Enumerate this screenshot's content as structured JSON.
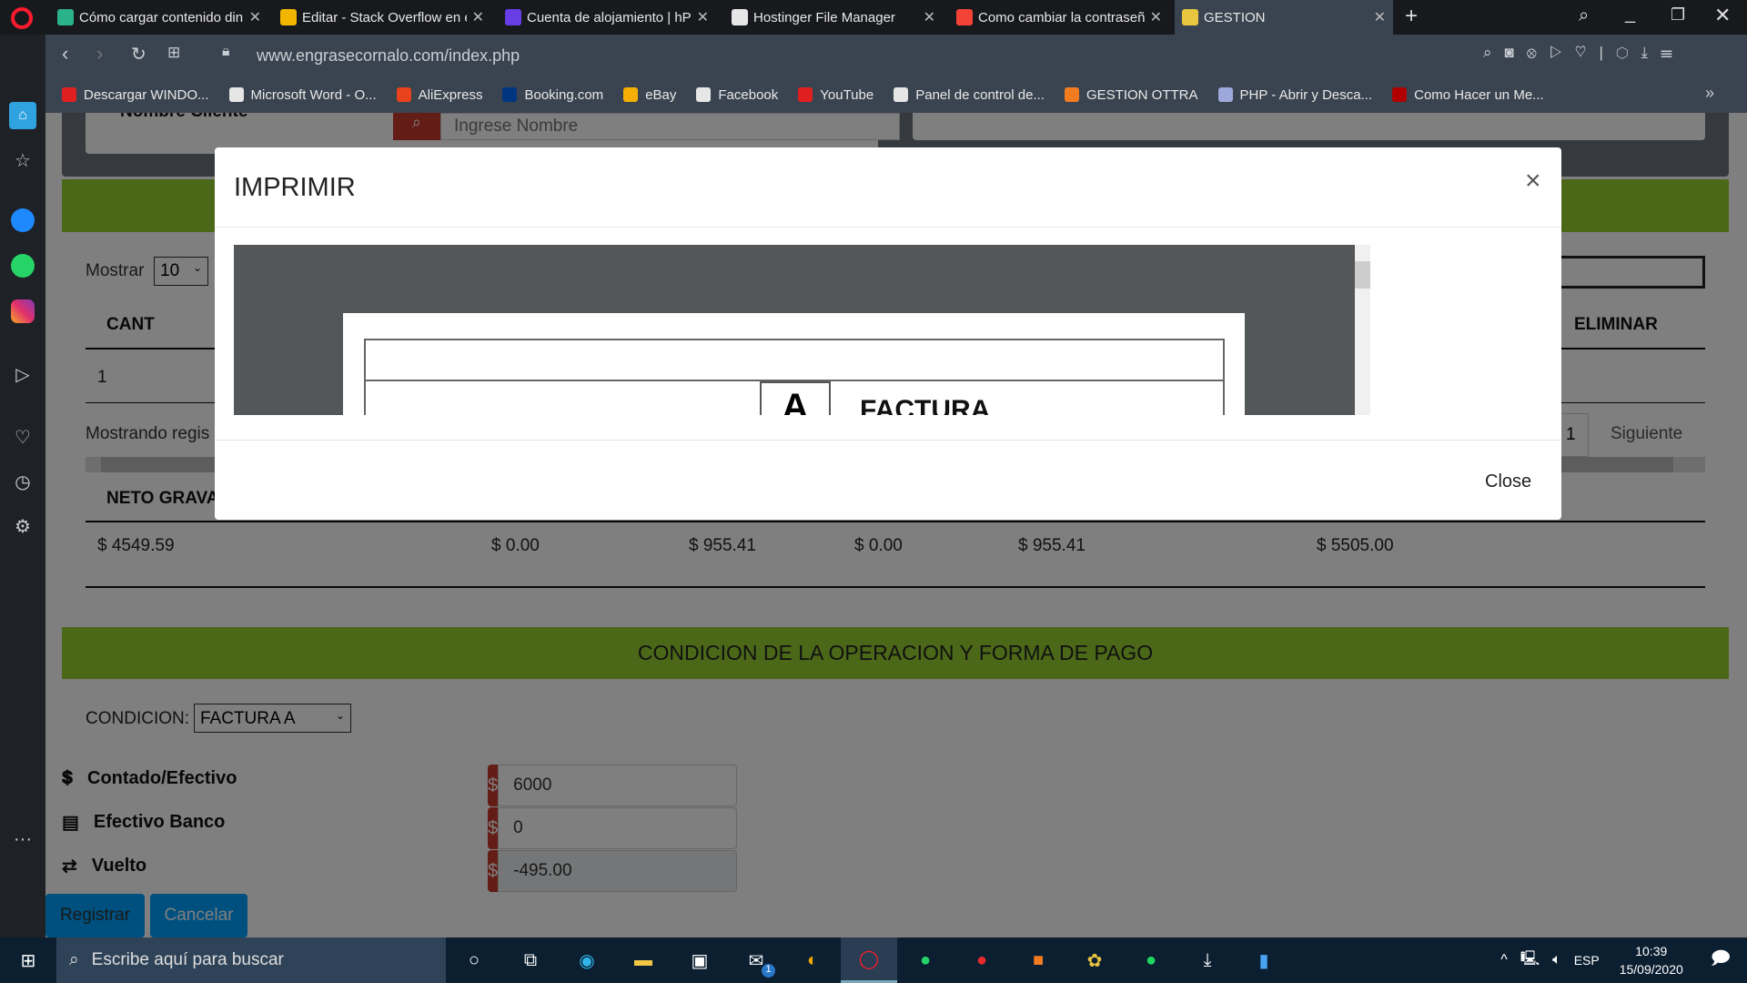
{
  "browser": {
    "tabs": [
      {
        "title": "Cómo cargar contenido din",
        "color": "#2ab38a"
      },
      {
        "title": "Editar - Stack Overflow en e",
        "color": "#f2b600"
      },
      {
        "title": "Cuenta de alojamiento | hP",
        "color": "#673de6"
      },
      {
        "title": "Hostinger File Manager",
        "color": "#e6e6e6"
      },
      {
        "title": "Como cambiar la contraseñ",
        "color": "#f44336"
      },
      {
        "title": "GESTION",
        "color": "#e8c640",
        "active": true
      }
    ],
    "url": "www.engrasecornalo.com/index.php",
    "bookmarks": [
      {
        "label": "Descargar WINDO...",
        "color": "#e02020"
      },
      {
        "label": "Microsoft Word - O...",
        "color": "#e6e6e6"
      },
      {
        "label": "AliExpress",
        "color": "#e8431c"
      },
      {
        "label": "Booking.com",
        "color": "#003580"
      },
      {
        "label": "eBay",
        "color": "#f5af02"
      },
      {
        "label": "Facebook",
        "color": "#e6e6e6"
      },
      {
        "label": "YouTube",
        "color": "#e02020"
      },
      {
        "label": "Panel de control de...",
        "color": "#e6e6e6"
      },
      {
        "label": "GESTION OTTRA",
        "color": "#f47c20"
      },
      {
        "label": "PHP - Abrir y Desca...",
        "color": "#9fa8da"
      },
      {
        "label": "Como Hacer un Me...",
        "color": "#b00000"
      }
    ]
  },
  "page": {
    "client_label": "Nombre Cliente",
    "client_placeholder": "Ingrese Nombre",
    "show_label": "Mostrar",
    "show_value": "10",
    "col_cant": "CANT",
    "col_eliminar": "ELIMINAR",
    "row_cant": "1",
    "showing": "Mostrando regis",
    "page_num": "1",
    "next": "Siguiente",
    "col_neto": "NETO GRAVA",
    "totals": [
      "$ 4549.59",
      "$ 0.00",
      "$ 955.41",
      "$ 0.00",
      "$ 955.41",
      "$ 5505.00"
    ],
    "section_title": "CONDICION DE LA OPERACION Y FORMA DE PAGO",
    "condicion_label": "CONDICION:",
    "condicion_value": "FACTURA A",
    "payments": [
      {
        "label": "Contado/Efectivo",
        "icon": "cash-hand-icon",
        "value": "6000"
      },
      {
        "label": "Efectivo Banco",
        "icon": "credit-card-icon",
        "value": "0"
      },
      {
        "label": "Vuelto",
        "icon": "exchange-icon",
        "value": "-495.00"
      }
    ],
    "currency": "$",
    "register": "Registrar",
    "cancel": "Cancelar"
  },
  "modal": {
    "title": "IMPRIMIR",
    "close_x": "×",
    "close": "Close",
    "invoice_letter": "A",
    "invoice_title": "FACTURA"
  },
  "taskbar": {
    "search_placeholder": "Escribe aquí para buscar",
    "lang": "ESP",
    "time": "10:39",
    "date": "15/09/2020",
    "mail_badge": "1"
  }
}
